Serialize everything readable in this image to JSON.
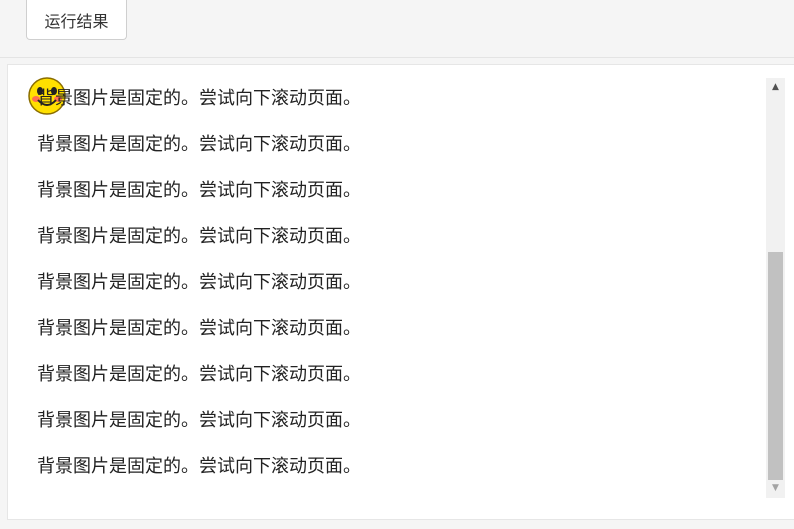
{
  "toolbar": {
    "run_label": "运行结果"
  },
  "result": {
    "background_icon": "smiley-face-icon",
    "lines": [
      "背景图片是固定的。尝试向下滚动页面。",
      "背景图片是固定的。尝试向下滚动页面。",
      "背景图片是固定的。尝试向下滚动页面。",
      "背景图片是固定的。尝试向下滚动页面。",
      "背景图片是固定的。尝试向下滚动页面。",
      "背景图片是固定的。尝试向下滚动页面。",
      "背景图片是固定的。尝试向下滚动页面。",
      "背景图片是固定的。尝试向下滚动页面。",
      "背景图片是固定的。尝试向下滚动页面。"
    ]
  },
  "scrollbar": {
    "up_icon": "scroll-up-arrow-icon",
    "down_icon": "scroll-down-arrow-icon",
    "scroll_position": 0.6
  }
}
